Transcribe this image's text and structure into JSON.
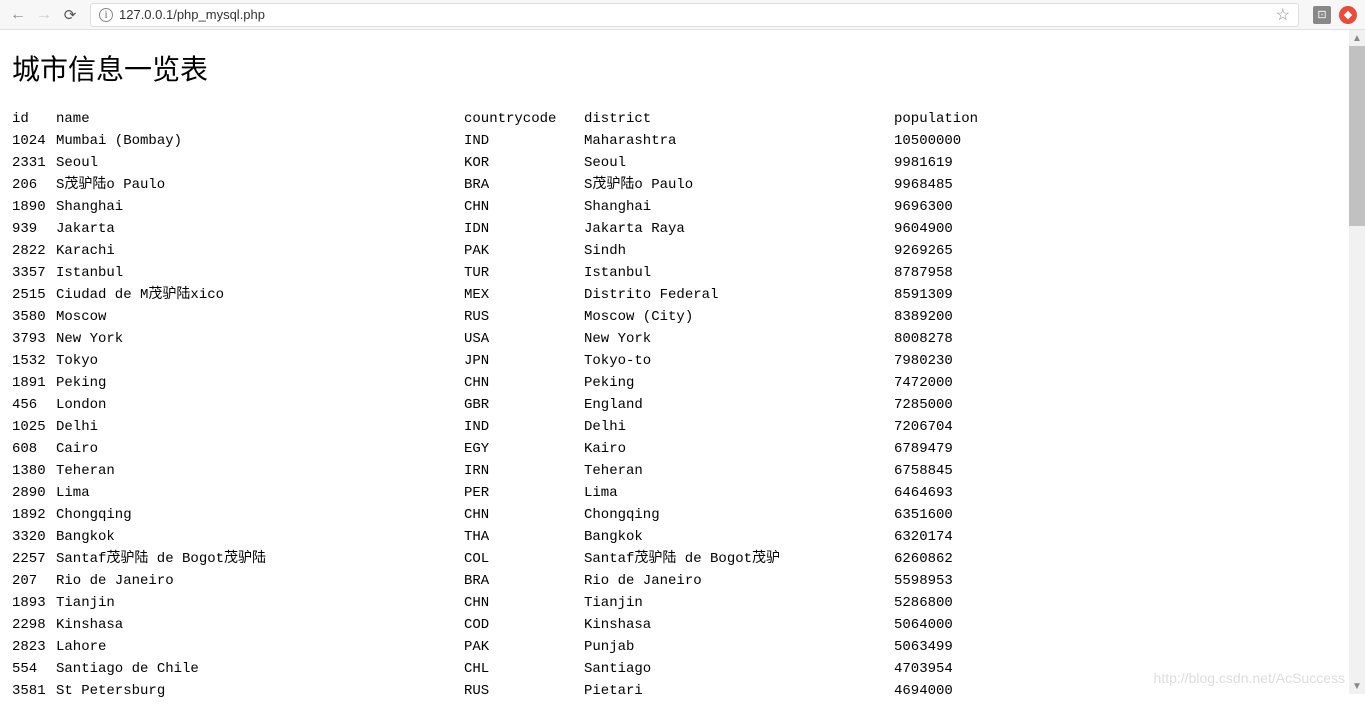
{
  "browser": {
    "url": "127.0.0.1/php_mysql.php"
  },
  "page": {
    "title": "城市信息一览表"
  },
  "table": {
    "headers": {
      "id": "id",
      "name": "name",
      "countrycode": "countrycode",
      "district": "district",
      "population": "population"
    },
    "rows": [
      {
        "id": "1024",
        "name": "Mumbai (Bombay)",
        "countrycode": "IND",
        "district": "Maharashtra",
        "population": "10500000"
      },
      {
        "id": "2331",
        "name": "Seoul",
        "countrycode": "KOR",
        "district": "Seoul",
        "population": "9981619"
      },
      {
        "id": "206",
        "name": "S茂驴陆o Paulo",
        "countrycode": "BRA",
        "district": "S茂驴陆o Paulo",
        "population": "9968485"
      },
      {
        "id": "1890",
        "name": "Shanghai",
        "countrycode": "CHN",
        "district": "Shanghai",
        "population": "9696300"
      },
      {
        "id": "939",
        "name": "Jakarta",
        "countrycode": "IDN",
        "district": "Jakarta Raya",
        "population": "9604900"
      },
      {
        "id": "2822",
        "name": "Karachi",
        "countrycode": "PAK",
        "district": "Sindh",
        "population": "9269265"
      },
      {
        "id": "3357",
        "name": "Istanbul",
        "countrycode": "TUR",
        "district": "Istanbul",
        "population": "8787958"
      },
      {
        "id": "2515",
        "name": "Ciudad de M茂驴陆xico",
        "countrycode": "MEX",
        "district": "Distrito Federal",
        "population": "8591309"
      },
      {
        "id": "3580",
        "name": "Moscow",
        "countrycode": "RUS",
        "district": "Moscow (City)",
        "population": "8389200"
      },
      {
        "id": "3793",
        "name": "New York",
        "countrycode": "USA",
        "district": "New York",
        "population": "8008278"
      },
      {
        "id": "1532",
        "name": "Tokyo",
        "countrycode": "JPN",
        "district": "Tokyo-to",
        "population": "7980230"
      },
      {
        "id": "1891",
        "name": "Peking",
        "countrycode": "CHN",
        "district": "Peking",
        "population": "7472000"
      },
      {
        "id": "456",
        "name": "London",
        "countrycode": "GBR",
        "district": "England",
        "population": "7285000"
      },
      {
        "id": "1025",
        "name": "Delhi",
        "countrycode": "IND",
        "district": "Delhi",
        "population": "7206704"
      },
      {
        "id": "608",
        "name": "Cairo",
        "countrycode": "EGY",
        "district": "Kairo",
        "population": "6789479"
      },
      {
        "id": "1380",
        "name": "Teheran",
        "countrycode": "IRN",
        "district": "Teheran",
        "population": "6758845"
      },
      {
        "id": "2890",
        "name": "Lima",
        "countrycode": "PER",
        "district": "Lima",
        "population": "6464693"
      },
      {
        "id": "1892",
        "name": "Chongqing",
        "countrycode": "CHN",
        "district": "Chongqing",
        "population": "6351600"
      },
      {
        "id": "3320",
        "name": "Bangkok",
        "countrycode": "THA",
        "district": "Bangkok",
        "population": "6320174"
      },
      {
        "id": "2257",
        "name": "Santaf茂驴陆 de Bogot茂驴陆",
        "countrycode": "COL",
        "district": "Santaf茂驴陆 de Bogot茂驴",
        "population": "6260862"
      },
      {
        "id": "207",
        "name": "Rio de Janeiro",
        "countrycode": "BRA",
        "district": "Rio de Janeiro",
        "population": "5598953"
      },
      {
        "id": "1893",
        "name": "Tianjin",
        "countrycode": "CHN",
        "district": "Tianjin",
        "population": "5286800"
      },
      {
        "id": "2298",
        "name": "Kinshasa",
        "countrycode": "COD",
        "district": "Kinshasa",
        "population": "5064000"
      },
      {
        "id": "2823",
        "name": "Lahore",
        "countrycode": "PAK",
        "district": "Punjab",
        "population": "5063499"
      },
      {
        "id": "554",
        "name": "Santiago de Chile",
        "countrycode": "CHL",
        "district": "Santiago",
        "population": "4703954"
      },
      {
        "id": "3581",
        "name": "St Petersburg",
        "countrycode": "RUS",
        "district": "Pietari",
        "population": "4694000"
      }
    ]
  },
  "watermark": "http://blog.csdn.net/AcSuccess"
}
